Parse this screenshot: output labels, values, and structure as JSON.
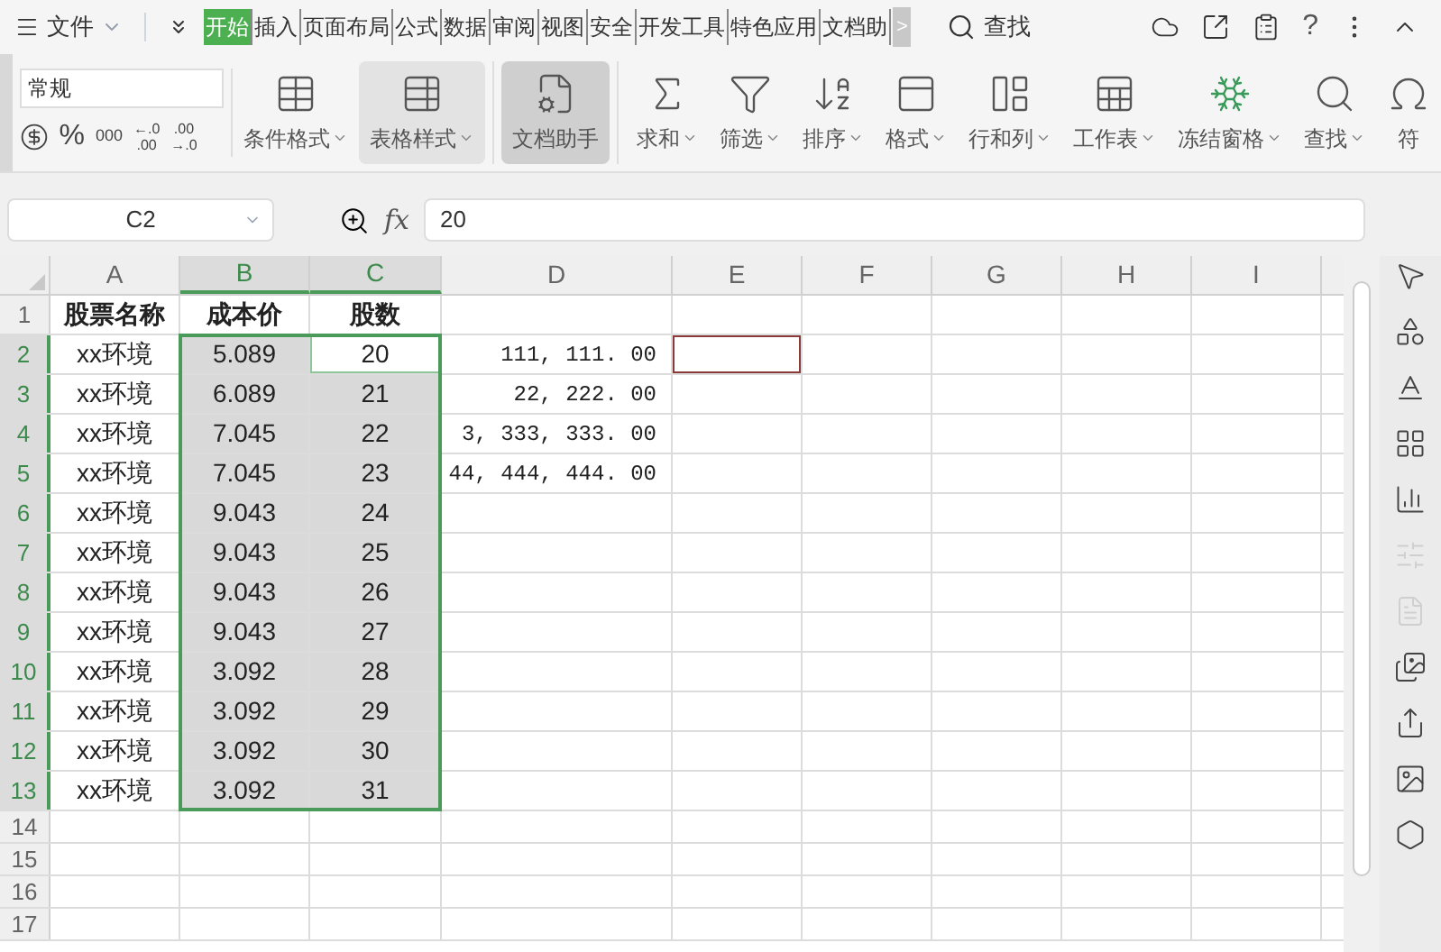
{
  "menu": {
    "file": "文件"
  },
  "tabs": [
    {
      "label": "开始",
      "selected": true
    },
    {
      "label": "插入",
      "selected": false
    },
    {
      "label": "页面布局",
      "selected": false
    },
    {
      "label": "公式",
      "selected": false
    },
    {
      "label": "数据",
      "selected": false
    },
    {
      "label": "审阅",
      "selected": false
    },
    {
      "label": "视图",
      "selected": false
    },
    {
      "label": "安全",
      "selected": false
    },
    {
      "label": "开发工具",
      "selected": false
    },
    {
      "label": "特色应用",
      "selected": false
    },
    {
      "label": "文档助",
      "selected": false
    }
  ],
  "more_tabs": ">",
  "search": {
    "label": "查找"
  },
  "help": "?",
  "ribbon": {
    "number_format": "常规",
    "percent": "%",
    "thousands": "000",
    "decimal_buttons": [
      {
        "top": "←.0",
        "bottom": ".00"
      },
      {
        "top": ".00",
        "bottom": "→.0"
      }
    ],
    "buttons": [
      {
        "label": "条件格式",
        "hovered": false,
        "pressed": false,
        "dropdown": true
      },
      {
        "label": "表格样式",
        "hovered": true,
        "pressed": false,
        "dropdown": true
      },
      {
        "label": "文档助手",
        "hovered": false,
        "pressed": true,
        "dropdown": false
      },
      {
        "label": "求和",
        "hovered": false,
        "pressed": false,
        "dropdown": true
      },
      {
        "label": "筛选",
        "hovered": false,
        "pressed": false,
        "dropdown": true
      },
      {
        "label": "排序",
        "hovered": false,
        "pressed": false,
        "dropdown": true
      },
      {
        "label": "格式",
        "hovered": false,
        "pressed": false,
        "dropdown": true
      },
      {
        "label": "行和列",
        "hovered": false,
        "pressed": false,
        "dropdown": true
      },
      {
        "label": "工作表",
        "hovered": false,
        "pressed": false,
        "dropdown": true
      },
      {
        "label": "冻结窗格",
        "hovered": false,
        "pressed": false,
        "dropdown": true
      },
      {
        "label": "查找",
        "hovered": false,
        "pressed": false,
        "dropdown": true
      },
      {
        "label": "符",
        "hovered": false,
        "pressed": false,
        "dropdown": false
      }
    ]
  },
  "formula_bar": {
    "name_box": "C2",
    "fx": "fx",
    "value": "20"
  },
  "columns": [
    {
      "label": "A",
      "selected": false
    },
    {
      "label": "B",
      "selected": true
    },
    {
      "label": "C",
      "selected": true
    },
    {
      "label": "D",
      "selected": false
    },
    {
      "label": "E",
      "selected": false
    },
    {
      "label": "F",
      "selected": false
    },
    {
      "label": "G",
      "selected": false
    },
    {
      "label": "H",
      "selected": false
    },
    {
      "label": "I",
      "selected": false
    }
  ],
  "rows": [
    {
      "label": "1",
      "selected": false,
      "cells": [
        {
          "text": "股票名称",
          "selected": false,
          "active": false,
          "outlined": false
        },
        {
          "text": "成本价",
          "selected": false,
          "active": false,
          "outlined": false
        },
        {
          "text": "股数",
          "selected": false,
          "active": false,
          "outlined": false
        }
      ]
    },
    {
      "label": "2",
      "selected": true,
      "cells": [
        {
          "text": "xx环境",
          "selected": false,
          "active": false,
          "outlined": false
        },
        {
          "text": "5.089",
          "selected": true,
          "active": false,
          "outlined": false
        },
        {
          "text": "20",
          "selected": true,
          "active": true,
          "outlined": false
        },
        {
          "text": "111, 111. 00",
          "selected": false,
          "active": false,
          "outlined": false
        },
        {
          "selected": false,
          "active": false,
          "outlined": true
        }
      ]
    },
    {
      "label": "3",
      "selected": true,
      "cells": [
        {
          "text": "xx环境",
          "selected": false,
          "active": false,
          "outlined": false
        },
        {
          "text": "6.089",
          "selected": true,
          "active": false,
          "outlined": false
        },
        {
          "text": "21",
          "selected": true,
          "active": false,
          "outlined": false
        },
        {
          "text": "22, 222. 00",
          "selected": false,
          "active": false,
          "outlined": false
        }
      ]
    },
    {
      "label": "4",
      "selected": true,
      "cells": [
        {
          "text": "xx环境",
          "selected": false,
          "active": false,
          "outlined": false
        },
        {
          "text": "7.045",
          "selected": true,
          "active": false,
          "outlined": false
        },
        {
          "text": "22",
          "selected": true,
          "active": false,
          "outlined": false
        },
        {
          "text": "3, 333, 333. 00",
          "selected": false,
          "active": false,
          "outlined": false
        }
      ]
    },
    {
      "label": "5",
      "selected": true,
      "cells": [
        {
          "text": "xx环境",
          "selected": false,
          "active": false,
          "outlined": false
        },
        {
          "text": "7.045",
          "selected": true,
          "active": false,
          "outlined": false
        },
        {
          "text": "23",
          "selected": true,
          "active": false,
          "outlined": false
        },
        {
          "text": "44, 444, 444. 00",
          "selected": false,
          "active": false,
          "outlined": false
        }
      ]
    },
    {
      "label": "6",
      "selected": true,
      "cells": [
        {
          "text": "xx环境",
          "selected": false,
          "active": false,
          "outlined": false
        },
        {
          "text": "9.043",
          "selected": true,
          "active": false,
          "outlined": false
        },
        {
          "text": "24",
          "selected": true,
          "active": false,
          "outlined": false
        }
      ]
    },
    {
      "label": "7",
      "selected": true,
      "cells": [
        {
          "text": "xx环境",
          "selected": false,
          "active": false,
          "outlined": false
        },
        {
          "text": "9.043",
          "selected": true,
          "active": false,
          "outlined": false
        },
        {
          "text": "25",
          "selected": true,
          "active": false,
          "outlined": false
        }
      ]
    },
    {
      "label": "8",
      "selected": true,
      "cells": [
        {
          "text": "xx环境",
          "selected": false,
          "active": false,
          "outlined": false
        },
        {
          "text": "9.043",
          "selected": true,
          "active": false,
          "outlined": false
        },
        {
          "text": "26",
          "selected": true,
          "active": false,
          "outlined": false
        }
      ]
    },
    {
      "label": "9",
      "selected": true,
      "cells": [
        {
          "text": "xx环境",
          "selected": false,
          "active": false,
          "outlined": false
        },
        {
          "text": "9.043",
          "selected": true,
          "active": false,
          "outlined": false
        },
        {
          "text": "27",
          "selected": true,
          "active": false,
          "outlined": false
        }
      ]
    },
    {
      "label": "10",
      "selected": true,
      "cells": [
        {
          "text": "xx环境",
          "selected": false,
          "active": false,
          "outlined": false
        },
        {
          "text": "3.092",
          "selected": true,
          "active": false,
          "outlined": false
        },
        {
          "text": "28",
          "selected": true,
          "active": false,
          "outlined": false
        }
      ]
    },
    {
      "label": "11",
      "selected": true,
      "cells": [
        {
          "text": "xx环境",
          "selected": false,
          "active": false,
          "outlined": false
        },
        {
          "text": "3.092",
          "selected": true,
          "active": false,
          "outlined": false
        },
        {
          "text": "29",
          "selected": true,
          "active": false,
          "outlined": false
        }
      ]
    },
    {
      "label": "12",
      "selected": true,
      "cells": [
        {
          "text": "xx环境",
          "selected": false,
          "active": false,
          "outlined": false
        },
        {
          "text": "3.092",
          "selected": true,
          "active": false,
          "outlined": false
        },
        {
          "text": "30",
          "selected": true,
          "active": false,
          "outlined": false
        }
      ]
    },
    {
      "label": "13",
      "selected": true,
      "cells": [
        {
          "text": "xx环境",
          "selected": false,
          "active": false,
          "outlined": false
        },
        {
          "text": "3.092",
          "selected": true,
          "active": false,
          "outlined": false
        },
        {
          "text": "31",
          "selected": true,
          "active": false,
          "outlined": false
        }
      ]
    },
    {
      "label": "14",
      "selected": false
    },
    {
      "label": "15",
      "selected": false
    },
    {
      "label": "16",
      "selected": false
    },
    {
      "label": "17",
      "selected": false
    }
  ],
  "sidebar": {
    "tools": [
      {
        "disabled": false
      },
      {
        "disabled": false
      },
      {
        "disabled": false
      },
      {
        "disabled": false
      },
      {
        "disabled": false
      },
      {
        "disabled": true
      },
      {
        "disabled": true
      },
      {
        "disabled": false
      },
      {
        "disabled": false
      },
      {
        "disabled": false
      },
      {
        "disabled": false
      }
    ]
  }
}
